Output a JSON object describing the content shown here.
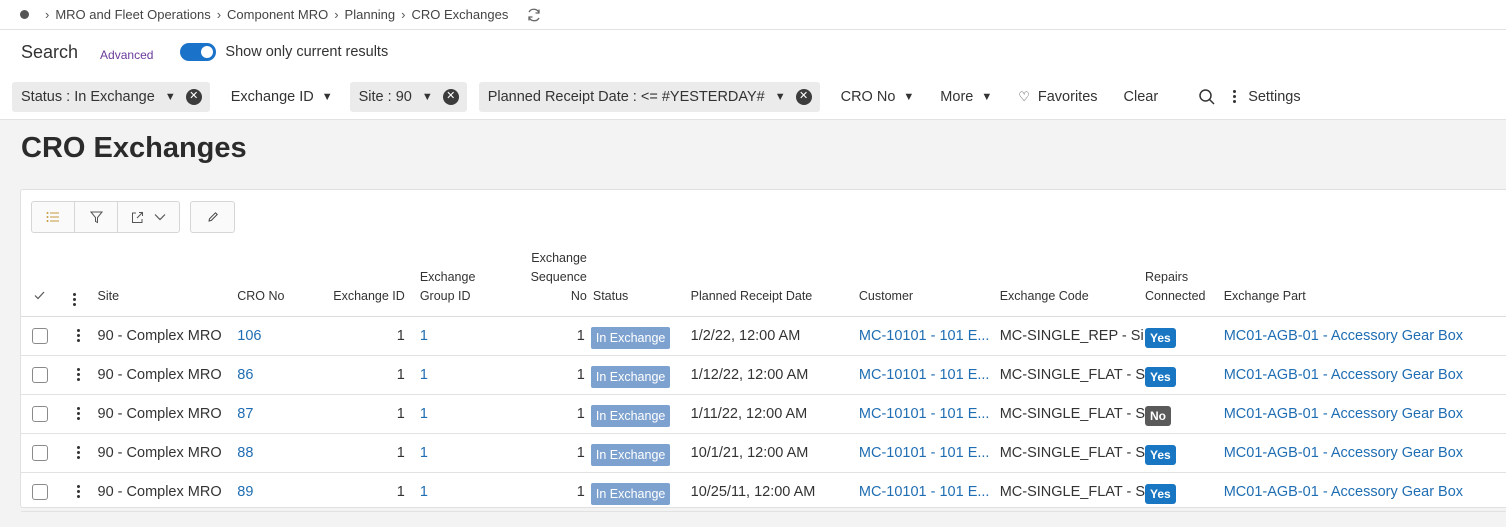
{
  "breadcrumb": [
    "MRO and Fleet Operations",
    "Component MRO",
    "Planning",
    "CRO Exchanges"
  ],
  "search": {
    "title": "Search",
    "advanced": "Advanced",
    "toggle_label": "Show only current results"
  },
  "filters": {
    "status": "Status : In Exchange",
    "exchange_id": "Exchange ID",
    "site": "Site : 90",
    "planned": "Planned Receipt Date : <= #YESTERDAY#",
    "cro_no": "CRO No",
    "more": "More",
    "favorites": "Favorites",
    "clear": "Clear",
    "settings": "Settings"
  },
  "page_title": "CRO Exchanges",
  "columns": {
    "site": "Site",
    "cro_no": "CRO No",
    "exchange_id": "Exchange ID",
    "exchange_group_id": [
      "Exchange",
      "Group ID"
    ],
    "exchange_seq_no": [
      "Exchange",
      "Sequence",
      "No"
    ],
    "status": "Status",
    "planned_receipt_date": "Planned Receipt Date",
    "customer": "Customer",
    "exchange_code": "Exchange Code",
    "repairs_connected": [
      "Repairs",
      "Connected"
    ],
    "exchange_part": "Exchange Part"
  },
  "rows": [
    {
      "site": "90 - Complex MRO",
      "cro_no": "106",
      "exchange_id": "1",
      "group_id": "1",
      "seq_no": "1",
      "status": "In Exchange",
      "date": "1/2/22, 12:00 AM",
      "customer": "MC-10101 - 101 E...",
      "code": "MC-SINGLE_REP - Si",
      "repairs": "Yes",
      "part": "MC01-AGB-01 - Accessory Gear Box"
    },
    {
      "site": "90 - Complex MRO",
      "cro_no": "86",
      "exchange_id": "1",
      "group_id": "1",
      "seq_no": "1",
      "status": "In Exchange",
      "date": "1/12/22, 12:00 AM",
      "customer": "MC-10101 - 101 E...",
      "code": "MC-SINGLE_FLAT - S",
      "repairs": "Yes",
      "part": "MC01-AGB-01 - Accessory Gear Box"
    },
    {
      "site": "90 - Complex MRO",
      "cro_no": "87",
      "exchange_id": "1",
      "group_id": "1",
      "seq_no": "1",
      "status": "In Exchange",
      "date": "1/11/22, 12:00 AM",
      "customer": "MC-10101 - 101 E...",
      "code": "MC-SINGLE_FLAT - S",
      "repairs": "No",
      "part": "MC01-AGB-01 - Accessory Gear Box"
    },
    {
      "site": "90 - Complex MRO",
      "cro_no": "88",
      "exchange_id": "1",
      "group_id": "1",
      "seq_no": "1",
      "status": "In Exchange",
      "date": "10/1/21, 12:00 AM",
      "customer": "MC-10101 - 101 E...",
      "code": "MC-SINGLE_FLAT - S",
      "repairs": "Yes",
      "part": "MC01-AGB-01 - Accessory Gear Box"
    },
    {
      "site": "90 - Complex MRO",
      "cro_no": "89",
      "exchange_id": "1",
      "group_id": "1",
      "seq_no": "1",
      "status": "In Exchange",
      "date": "10/25/11, 12:00 AM",
      "customer": "MC-10101 - 101 E...",
      "code": "MC-SINGLE_FLAT - S",
      "repairs": "Yes",
      "part": "MC01-AGB-01 - Accessory Gear Box"
    }
  ],
  "colors": {
    "link": "#1f6db2",
    "toggle": "#1a73c8",
    "status_badge": "#7da2d0",
    "yes_badge": "#1876c2",
    "no_badge": "#5a5a5a"
  },
  "icons": {
    "refresh": "refresh-icon",
    "heart": "heart-icon",
    "search": "search-icon",
    "kebab": "kebab-icon"
  }
}
